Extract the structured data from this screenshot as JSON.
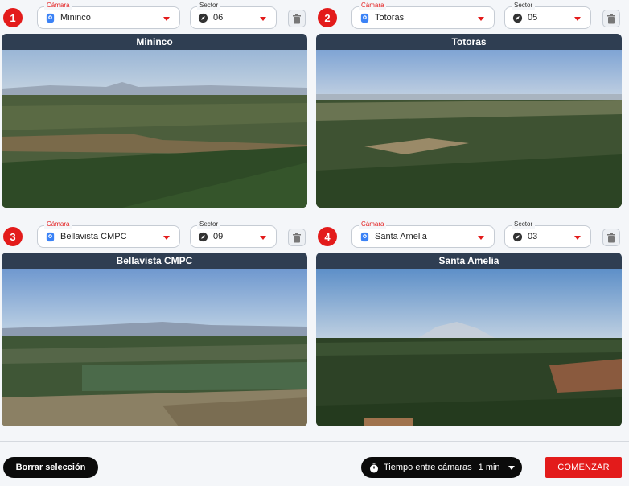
{
  "cells": [
    {
      "number": "1",
      "camera_label": "Cámara",
      "camera": "Mininco",
      "sector_label": "Sector",
      "sector": "06",
      "view_title": "Mininco"
    },
    {
      "number": "2",
      "camera_label": "Cámara",
      "camera": "Totoras",
      "sector_label": "Sector",
      "sector": "05",
      "view_title": "Totoras"
    },
    {
      "number": "3",
      "camera_label": "Cámara",
      "camera": "Bellavista CMPC",
      "sector_label": "Sector",
      "sector": "09",
      "view_title": "Bellavista CMPC"
    },
    {
      "number": "4",
      "camera_label": "Cámara",
      "camera": "Santa Amelia",
      "sector_label": "Sector",
      "sector": "03",
      "view_title": "Santa Amelia"
    }
  ],
  "footer": {
    "clear_label": "Borrar selección",
    "timer_label": "Tiempo entre cámaras",
    "timer_value": "1 min",
    "start_label": "COMENZAR"
  },
  "colors": {
    "accent": "#e31b1b",
    "title_bar": "#2f3e52",
    "button_dark": "#0b0b0b"
  },
  "icons": {
    "camera": "camera-icon",
    "sector": "compass-icon",
    "delete": "trash-icon",
    "timer": "stopwatch-icon"
  }
}
